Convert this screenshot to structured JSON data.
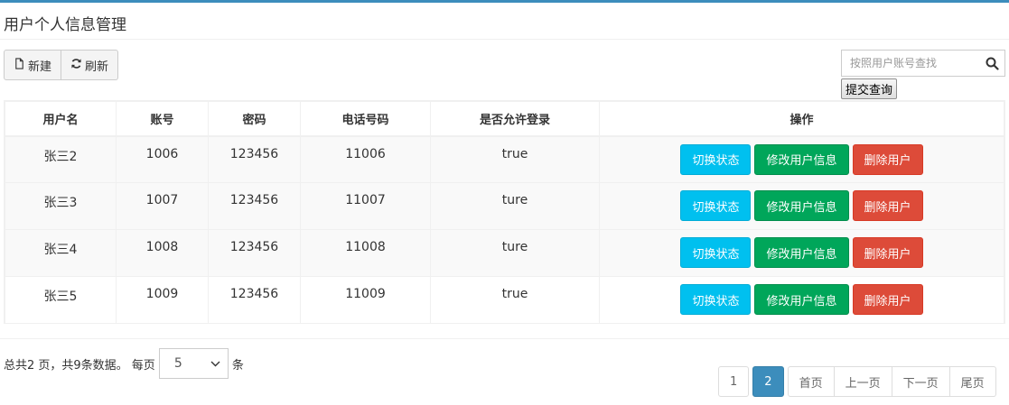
{
  "panel": {
    "title": "用户个人信息管理"
  },
  "toolbar": {
    "new_label": "新建",
    "refresh_label": "刷新"
  },
  "search": {
    "placeholder": "按照用户账号查找",
    "value": "",
    "submit_label": "提交查询"
  },
  "table": {
    "headers": [
      "用户名",
      "账号",
      "密码",
      "电话号码",
      "是否允许登录",
      "操作"
    ],
    "rows": [
      {
        "name": "张三2",
        "account": "1006",
        "password": "123456",
        "phone": "11006",
        "allow_login": "true"
      },
      {
        "name": "张三3",
        "account": "1007",
        "password": "123456",
        "phone": "11007",
        "allow_login": "ture"
      },
      {
        "name": "张三4",
        "account": "1008",
        "password": "123456",
        "phone": "11008",
        "allow_login": "ture"
      },
      {
        "name": "张三5",
        "account": "1009",
        "password": "123456",
        "phone": "11009",
        "allow_login": "true"
      }
    ],
    "actions": {
      "toggle_label": "切换状态",
      "edit_label": "修改用户信息",
      "delete_label": "删除用户"
    }
  },
  "footer": {
    "summary": "总共2 页，共9条数据。 每页",
    "page_size": "5",
    "unit": "条"
  },
  "pagination": {
    "pages": [
      "1",
      "2"
    ],
    "current_page": "2",
    "first_label": "首页",
    "prev_label": "上一页",
    "next_label": "下一页",
    "last_label": "尾页"
  },
  "colors": {
    "accent": "#3c8dbc",
    "info": "#00c0ef",
    "success": "#00a65a",
    "danger": "#dd4b39"
  }
}
